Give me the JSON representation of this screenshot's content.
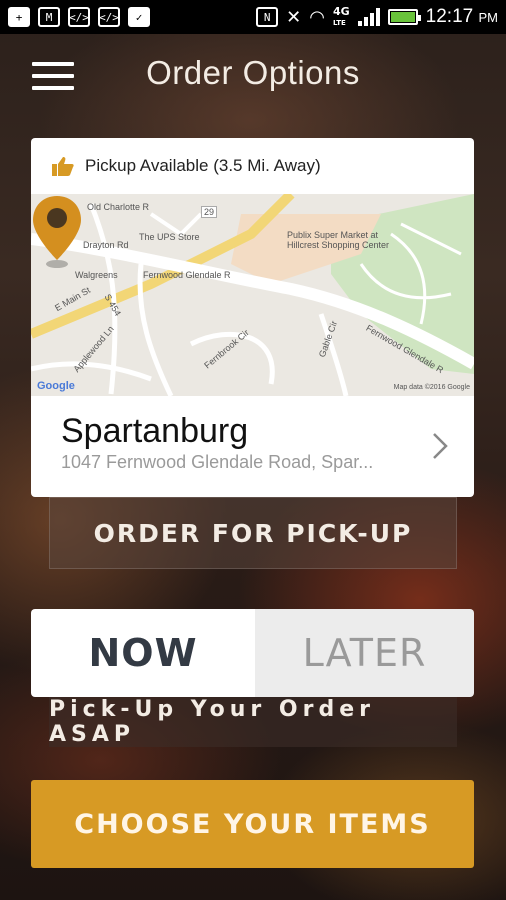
{
  "status_bar": {
    "time": "12:17",
    "ampm": "PM",
    "network": "4G",
    "network_sub": "LTE"
  },
  "header": {
    "title": "Order Options"
  },
  "location_card": {
    "availability": "Pickup Available (3.5 Mi. Away)",
    "store_name": "Spartanburg",
    "store_address": "1047 Fernwood Glendale Road, Spar...",
    "map_labels": {
      "old_charlotte": "Old Charlotte R",
      "ups": "The UPS Store",
      "publix": "Publix Super Market at",
      "hillcrest": "Hillcrest Shopping Center",
      "drayton": "Drayton Rd",
      "walgreens": "Walgreens",
      "fernwood1": "Fernwood Glendale R",
      "emain": "E Main St",
      "s454": "S 454",
      "applewood": "Applewood Ln",
      "fernbrook": "Fernbrook Cir",
      "gable": "Gable Cir",
      "fernwood2": "Fernwood Glendale R",
      "google": "Google",
      "mapdata": "Map data ©2016 Google",
      "route29": "29"
    }
  },
  "order_type": {
    "label": "ORDER FOR PICK-UP"
  },
  "timing": {
    "now": "NOW",
    "later": "LATER",
    "selected": "NOW",
    "hint": "Pick-Up Your Order ASAP"
  },
  "cta": {
    "label": "CHOOSE YOUR ITEMS"
  },
  "colors": {
    "accent": "#d79a24",
    "pin": "#d48f1f"
  }
}
